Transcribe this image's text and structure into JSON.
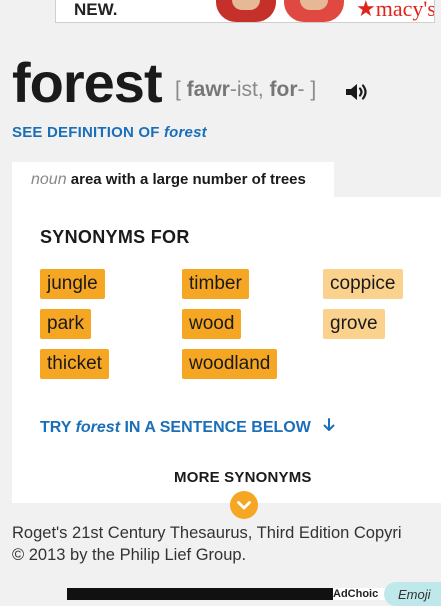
{
  "ad_top": {
    "text": "NEW.",
    "brand": "★macy's"
  },
  "entry": {
    "headword": "forest",
    "pron_open": "[ ",
    "pron_stress1": "fawr",
    "pron_rest1": "-ist, ",
    "pron_stress2": "for",
    "pron_rest2": "- ]",
    "speaker_icon": "speaker-icon",
    "see_def_prefix": "SEE DEFINITION OF ",
    "see_def_word": "forest"
  },
  "sense": {
    "pos": "noun",
    "definition": "area with a large number of trees"
  },
  "synonyms": {
    "title": "SYNONYMS FOR",
    "items": [
      {
        "word": "jungle",
        "strength": "strong"
      },
      {
        "word": "timber",
        "strength": "strong"
      },
      {
        "word": "coppice",
        "strength": "light"
      },
      {
        "word": "park",
        "strength": "strong"
      },
      {
        "word": "wood",
        "strength": "strong"
      },
      {
        "word": "grove",
        "strength": "light"
      },
      {
        "word": "thicket",
        "strength": "strong"
      },
      {
        "word": "woodland",
        "strength": "strong"
      }
    ],
    "colors": {
      "strong": "#f5a623",
      "light": "#fbd28d"
    }
  },
  "try_sentence": {
    "prefix": "TRY ",
    "word": "forest",
    "suffix": " IN A SENTENCE BELOW"
  },
  "more_synonyms": "MORE SYNONYMS",
  "source": {
    "line1": "Roget's 21st Century Thesaurus, Third Edition Copyri",
    "line2": "© 2013 by the Philip Lief Group."
  },
  "ad_bottom": {
    "adchoices": "AdChoic",
    "pill": "Emoji"
  },
  "colors": {
    "link": "#1b6fb8",
    "accent": "#f5a623"
  }
}
